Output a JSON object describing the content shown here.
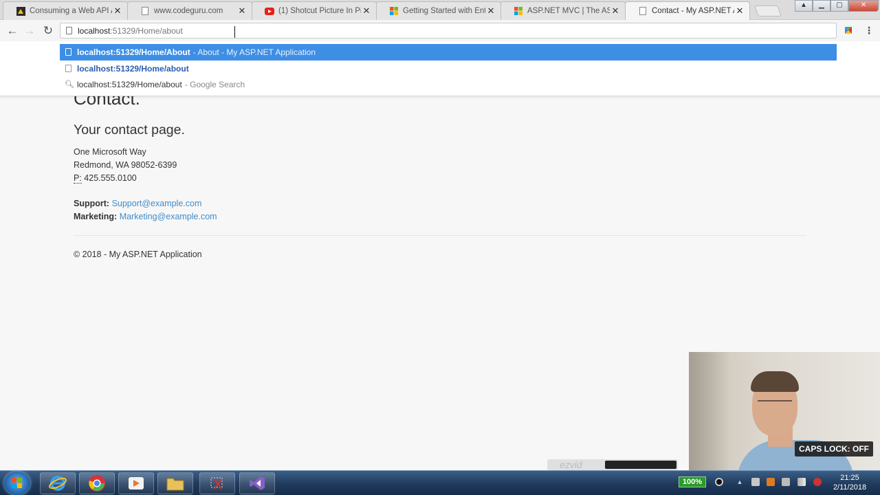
{
  "tabs": [
    {
      "title": "Consuming a Web API A",
      "icon": "codeguru-favicon-icon"
    },
    {
      "title": "www.codeguru.com",
      "icon": "page-icon"
    },
    {
      "title": "(1) Shotcut Picture In Pic",
      "icon": "youtube-icon"
    },
    {
      "title": "Getting Started with Ent",
      "icon": "microsoft-icon"
    },
    {
      "title": "ASP.NET MVC | The ASP",
      "icon": "microsoft-icon"
    },
    {
      "title": "Contact - My ASP.NET A",
      "icon": "page-icon",
      "active": true
    }
  ],
  "omnibox": {
    "host": "localhost",
    "rest": ":51329/Home/about"
  },
  "suggestions": [
    {
      "bold": "localhost:51329/Home/About",
      "sub": "- About - My ASP.NET Application"
    },
    {
      "bold": "localhost:51329/Home/about"
    },
    {
      "text": "localhost:51329/Home/about",
      "sub": "- Google Search"
    }
  ],
  "page": {
    "title": "Contact.",
    "subtitle": "Your contact page.",
    "address_line1": "One Microsoft Way",
    "address_line2": "Redmond, WA 98052-6399",
    "phone_abbr": "P:",
    "phone": "425.555.0100",
    "support_label": "Support:",
    "support_email": "Support@example.com",
    "marketing_label": "Marketing:",
    "marketing_email": "Marketing@example.com",
    "footer": "© 2018 - My ASP.NET Application"
  },
  "overlay": {
    "caps_lock": "CAPS LOCK: OFF",
    "recorder_brand": "ezvid"
  },
  "taskbar": {
    "battery": "100%",
    "time": "21:25",
    "date": "2/11/2018"
  },
  "colors": {
    "selection_blue": "#3d8ee5",
    "link_blue": "#428bca",
    "taskbar_blue": "#1f3a5c"
  }
}
